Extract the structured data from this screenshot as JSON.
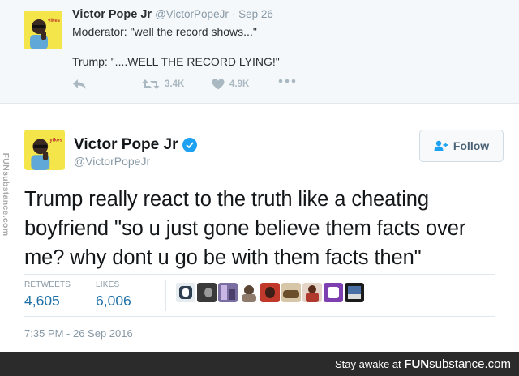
{
  "reply_tweet": {
    "name": "Victor Pope Jr",
    "handle": "@VictorPopeJr",
    "date": "Sep 26",
    "avatar_label": "yikes",
    "text_line1": "Moderator: \"well the record shows...\"",
    "text_line2": "Trump: \"....WELL THE RECORD LYING!\"",
    "retweets": "3.4K",
    "likes": "4.9K"
  },
  "main_tweet": {
    "name": "Victor Pope Jr",
    "handle": "@VictorPopeJr",
    "avatar_label": "yikes",
    "follow_label": "Follow",
    "text": "Trump really react to the truth like a cheating boyfriend \"so u just gone believe them facts over me? why dont u go be with them facts then\"",
    "retweets_label": "RETWEETS",
    "retweets": "4,605",
    "likes_label": "LIKES",
    "likes": "6,006",
    "timestamp": "7:35 PM - 26 Sep 2016"
  },
  "watermark": {
    "side": "FUNsubstance.com",
    "banner_prefix": "Stay awake at",
    "banner_brand_bold": "FUN",
    "banner_brand_rest": "substance.com"
  },
  "colors": {
    "link_blue": "#1e6fa7",
    "verified_blue": "#1da1f2",
    "muted_gray": "#8899a6",
    "avatar_yellow": "#f4e64a"
  }
}
